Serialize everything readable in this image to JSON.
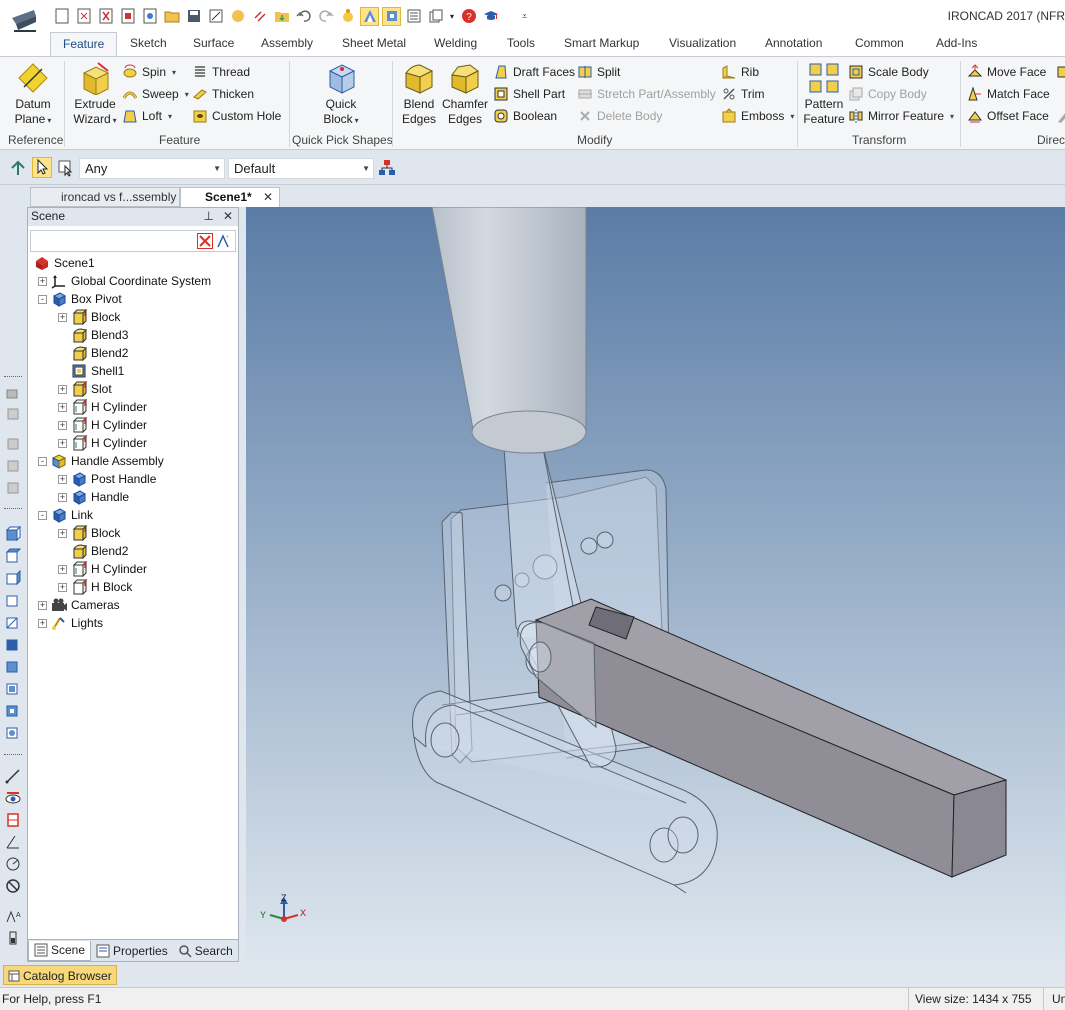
{
  "app": {
    "title": "IRONCAD 2017 (NFR"
  },
  "ribbon_tabs": [
    "Feature",
    "Sketch",
    "Surface",
    "Assembly",
    "Sheet Metal",
    "Welding",
    "Tools",
    "Smart Markup",
    "Visualization",
    "Annotation",
    "Common",
    "Add-Ins"
  ],
  "ribbon": {
    "groups": {
      "reference": "Reference",
      "feature": "Feature",
      "quick_pick": "Quick Pick Shapes",
      "modify": "Modify",
      "transform": "Transform",
      "direct": "Direct"
    },
    "datum_plane": [
      "Datum",
      "Plane"
    ],
    "extrude_wizard": [
      "Extrude",
      "Wizard"
    ],
    "spin": "Spin",
    "sweep": "Sweep",
    "loft": "Loft",
    "thread": "Thread",
    "thicken": "Thicken",
    "custom_hole": "Custom Hole",
    "quick_block": [
      "Quick",
      "Block"
    ],
    "blend_edges": [
      "Blend",
      "Edges"
    ],
    "chamfer_edges": [
      "Chamfer",
      "Edges"
    ],
    "draft_faces": "Draft Faces",
    "shell_part": "Shell Part",
    "boolean": "Boolean",
    "split": "Split",
    "stretch_part": "Stretch Part/Assembly",
    "delete_body": "Delete Body",
    "rib": "Rib",
    "trim": "Trim",
    "emboss": "Emboss",
    "pattern_feature": [
      "Pattern",
      "Feature"
    ],
    "scale_body": "Scale Body",
    "copy_body": "Copy Body",
    "mirror_feature": "Mirror Feature",
    "move_face": "Move Face",
    "match_face": "Match Face",
    "offset_face": "Offset Face"
  },
  "selection_toolbar": {
    "filter": "Any",
    "style": "Default"
  },
  "doc_tabs": [
    "ironcad vs f...ssembly",
    "Scene1*"
  ],
  "scene_panel": {
    "title": "Scene",
    "tree": [
      {
        "label": "Scene1",
        "icon": "scene-icon",
        "depth": 0,
        "expander": ""
      },
      {
        "label": "Global Coordinate System",
        "icon": "coordinate-system-icon",
        "depth": 1,
        "expander": "+"
      },
      {
        "label": "Box Pivot",
        "icon": "part-icon",
        "depth": 1,
        "expander": "-"
      },
      {
        "label": "Block",
        "icon": "block-feature-icon",
        "depth": 2,
        "expander": "+"
      },
      {
        "label": "Blend3",
        "icon": "blend-icon",
        "depth": 2,
        "expander": ""
      },
      {
        "label": "Blend2",
        "icon": "blend-icon",
        "depth": 2,
        "expander": ""
      },
      {
        "label": "Shell1",
        "icon": "shell-icon",
        "depth": 2,
        "expander": ""
      },
      {
        "label": "Slot",
        "icon": "slot-icon",
        "depth": 2,
        "expander": "+"
      },
      {
        "label": "H Cylinder",
        "icon": "hole-cylinder-icon",
        "depth": 2,
        "expander": "+"
      },
      {
        "label": "H Cylinder",
        "icon": "hole-cylinder-icon",
        "depth": 2,
        "expander": "+"
      },
      {
        "label": "H Cylinder",
        "icon": "hole-cylinder-icon",
        "depth": 2,
        "expander": "+"
      },
      {
        "label": "Handle Assembly",
        "icon": "assembly-icon",
        "depth": 1,
        "expander": "-"
      },
      {
        "label": "Post Handle",
        "icon": "part-icon",
        "depth": 2,
        "expander": "+"
      },
      {
        "label": "Handle",
        "icon": "part-icon",
        "depth": 2,
        "expander": "+"
      },
      {
        "label": "Link",
        "icon": "part-icon",
        "depth": 1,
        "expander": "-"
      },
      {
        "label": "Block",
        "icon": "block-feature-icon",
        "depth": 2,
        "expander": "+"
      },
      {
        "label": "Blend2",
        "icon": "blend-icon",
        "depth": 2,
        "expander": ""
      },
      {
        "label": "H Cylinder",
        "icon": "hole-cylinder-icon",
        "depth": 2,
        "expander": "+"
      },
      {
        "label": "H Block",
        "icon": "hole-block-icon",
        "depth": 2,
        "expander": "+"
      },
      {
        "label": "Cameras",
        "icon": "camera-icon",
        "depth": 1,
        "expander": "+"
      },
      {
        "label": "Lights",
        "icon": "light-icon",
        "depth": 1,
        "expander": "+"
      }
    ],
    "footer_tabs": [
      "Scene",
      "Properties",
      "Search"
    ]
  },
  "viewport": {
    "axis_labels": {
      "x": "X",
      "y": "Y",
      "z": "Z"
    },
    "colors": {
      "bg_top": "#5a7ca6",
      "bg_bottom": "#dde6ee",
      "part_bar": "#8f8d96",
      "cylinder": "#d4d9e0"
    }
  },
  "catalog_browser": "Catalog Browser",
  "status": {
    "help": "For Help, press F1",
    "view_size": "View size: 1434 x  755",
    "units": "Un"
  }
}
